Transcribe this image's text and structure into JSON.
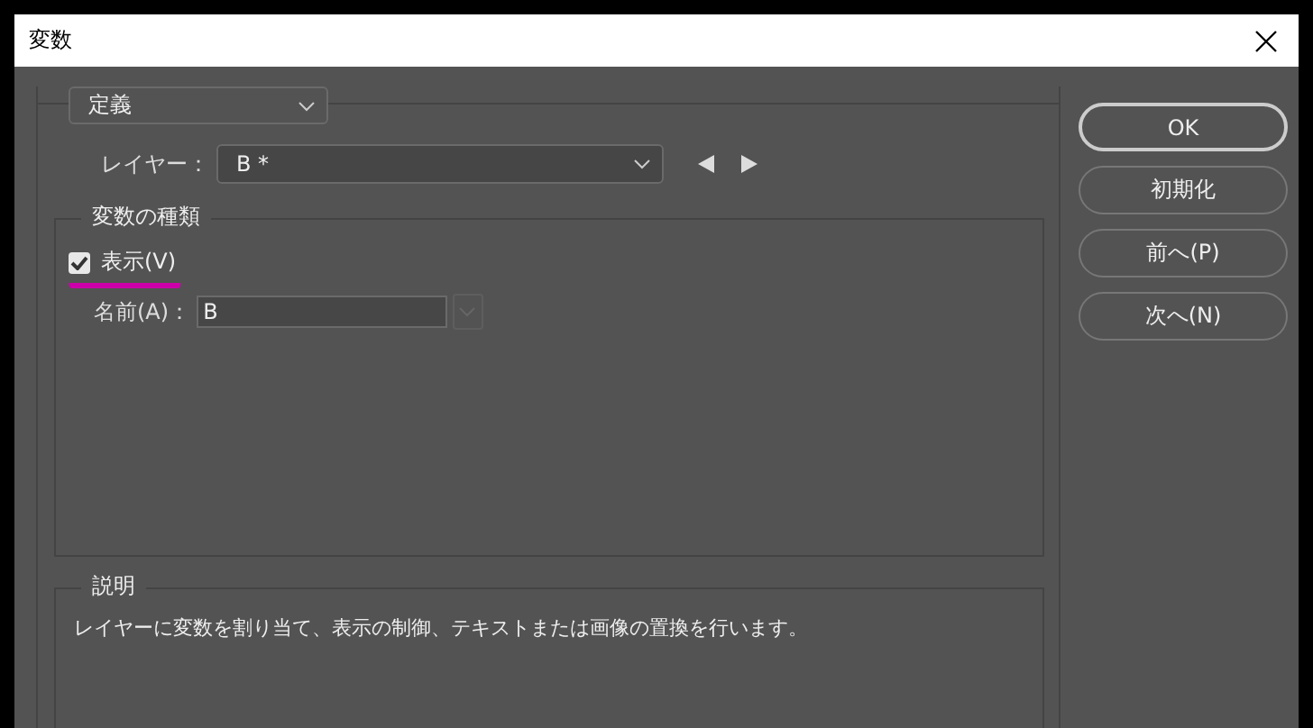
{
  "window": {
    "title": "変数"
  },
  "mode_select": {
    "value": "定義"
  },
  "layer": {
    "label": "レイヤー：",
    "value": "B *"
  },
  "variable_types": {
    "title": "変数の種類",
    "visibility": {
      "label": "表示(V)",
      "checked": true,
      "underlined": true
    },
    "name": {
      "label": "名前(A)：",
      "value": "B",
      "disabled_dropdown": true
    }
  },
  "description": {
    "title": "説明",
    "text": "レイヤーに変数を割り当て、表示の制御、テキストまたは画像の置換を行います。"
  },
  "buttons": [
    {
      "label": "OK",
      "default": true
    },
    {
      "label": "初期化",
      "default": false
    },
    {
      "label": "前へ(P)",
      "default": false
    },
    {
      "label": "次へ(N)",
      "default": false
    }
  ]
}
